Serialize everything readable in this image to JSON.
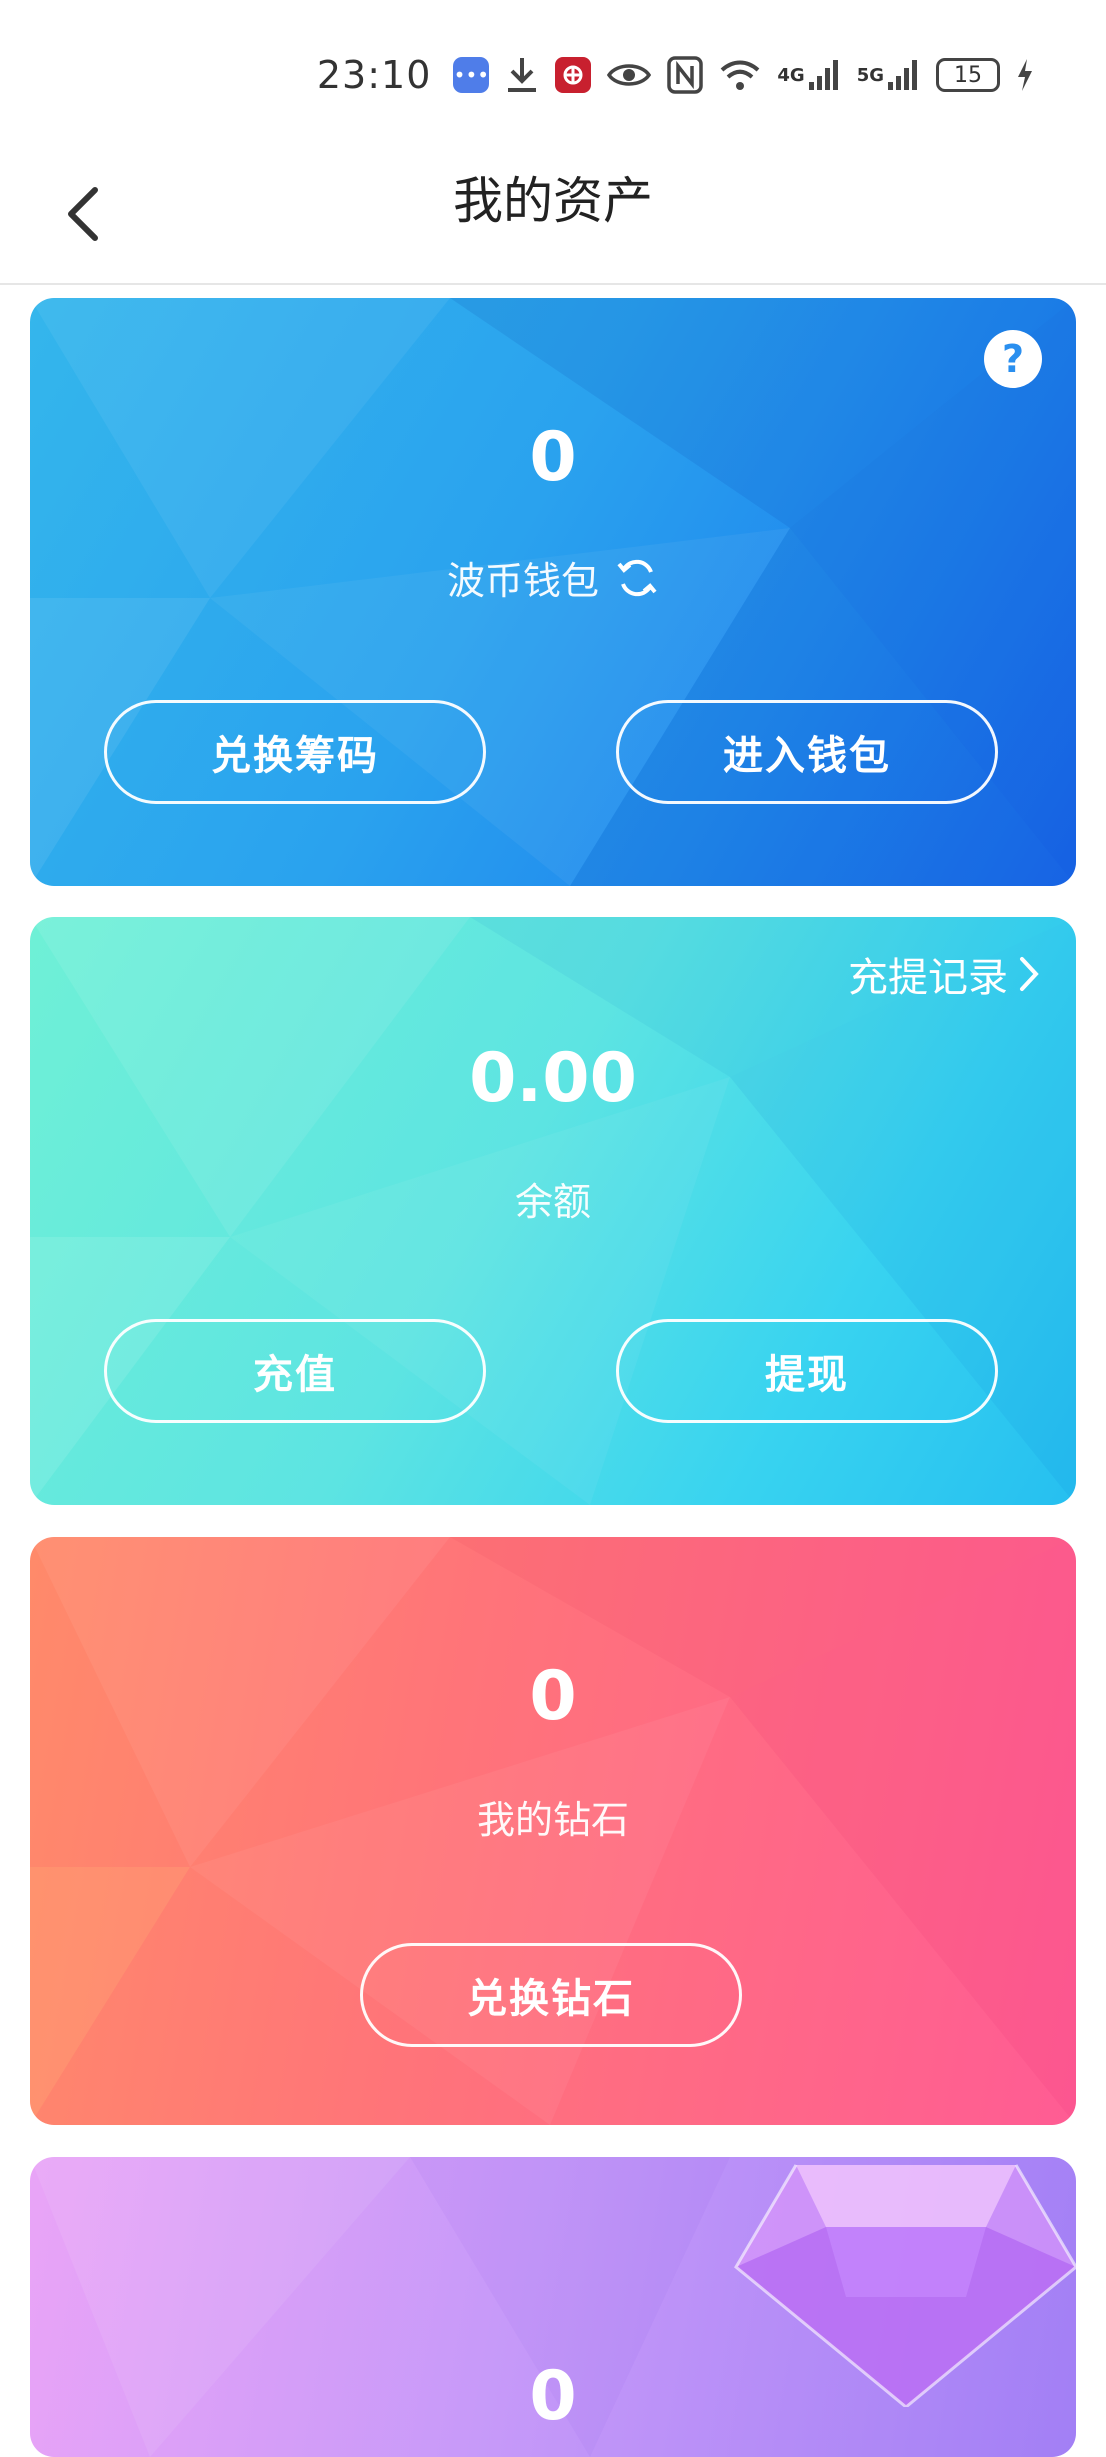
{
  "status_bar": {
    "time": "23:10",
    "battery": "15",
    "network_1": "4G",
    "network_2": "5G",
    "icons": [
      "message-icon",
      "download-icon",
      "bank-icon",
      "eye-icon",
      "nfc-icon",
      "wifi-icon",
      "signal-icon",
      "battery-icon",
      "charging-icon"
    ]
  },
  "nav": {
    "title": "我的资产"
  },
  "wallet_card": {
    "value": "0",
    "label": "波币钱包",
    "buttons": [
      "兑换筹码",
      "进入钱包"
    ],
    "color": "#2a9aee"
  },
  "balance_card": {
    "value": "0.00",
    "label": "余额",
    "record_link": "充提记录",
    "buttons": [
      "充值",
      "提现"
    ],
    "color": "#4ddbe6"
  },
  "diamond_card": {
    "value": "0",
    "label": "我的钻石",
    "button": "兑换钻石",
    "color": "#ff6f80"
  },
  "gem_card": {
    "value": "0",
    "color": "#b98cf7"
  }
}
